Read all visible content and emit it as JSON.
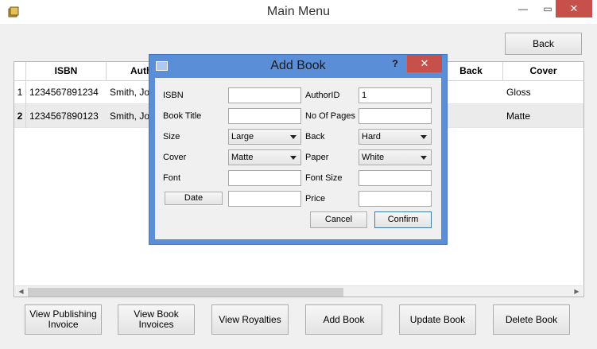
{
  "window": {
    "title": "Main Menu",
    "minimize": "—",
    "maximize": "▭",
    "close": "✕"
  },
  "toolbar": {
    "back_label": "Back"
  },
  "table": {
    "columns": [
      "ISBN",
      "Auth",
      "Back",
      "Cover"
    ],
    "rows": [
      {
        "num": "1",
        "isbn": "1234567891234",
        "author": "Smith, Joh",
        "back": "",
        "cover": "Gloss"
      },
      {
        "num": "2",
        "isbn": "1234567890123",
        "author": "Smith, Joh",
        "back": "",
        "cover": "Matte"
      }
    ]
  },
  "bottom_buttons": {
    "view_publishing_invoice": "View Publishing Invoice",
    "view_book_invoices": "View Book Invoices",
    "view_royalties": "View Royalties",
    "add_book": "Add Book",
    "update_book": "Update Book",
    "delete_book": "Delete Book"
  },
  "dialog": {
    "title": "Add Book",
    "help": "?",
    "close": "✕",
    "labels": {
      "isbn": "ISBN",
      "book_title": "Book Title",
      "size": "Size",
      "cover": "Cover",
      "font": "Font",
      "author_id": "AuthorID",
      "no_of_pages": "No Of Pages",
      "back": "Back",
      "paper": "Paper",
      "font_size": "Font Size",
      "price": "Price"
    },
    "values": {
      "isbn": "",
      "book_title": "",
      "size": "Large",
      "cover": "Matte",
      "font": "",
      "date": "",
      "author_id": "1",
      "no_of_pages": "",
      "back": "Hard",
      "paper": "White",
      "font_size": "",
      "price": ""
    },
    "date_button": "Date",
    "cancel_button": "Cancel",
    "confirm_button": "Confirm"
  },
  "colors": {
    "dialog_frame": "#5a8ed6",
    "close_button": "#c7504a",
    "background": "#f0f0f0"
  }
}
